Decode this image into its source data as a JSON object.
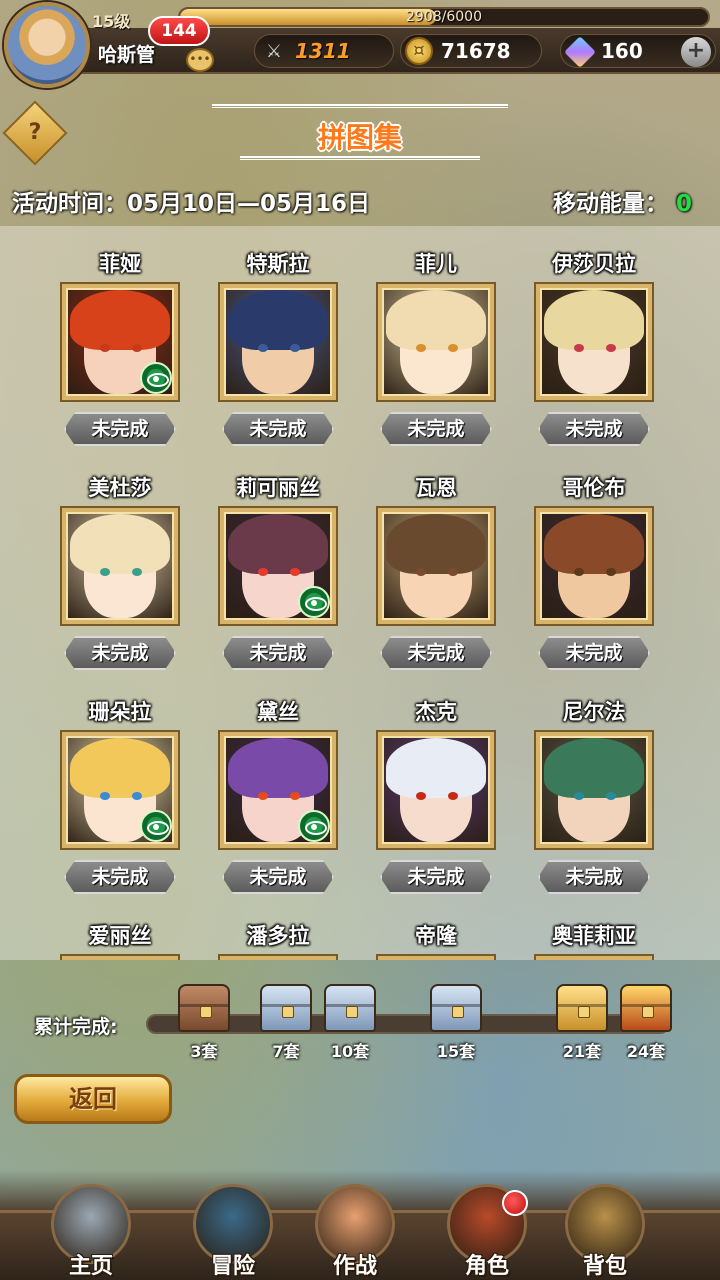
{
  "player": {
    "level": "15级",
    "name": "哈斯管",
    "xp_text": "2908/6000",
    "xp_fraction": 0.485,
    "message_count": "144"
  },
  "resources": {
    "power": "1311",
    "gold": "71678",
    "gems": "160",
    "plus": "+"
  },
  "page": {
    "title": "拼图集",
    "help_symbol": "?",
    "event_time": "活动时间：05月10日—05月16日",
    "move_energy_label": "移动能量：",
    "move_energy_value": "0"
  },
  "cards": [
    {
      "name": "菲娅",
      "status": "未完成",
      "viewable": true,
      "hair": "#d8421a",
      "skin": "#f6d2bc",
      "eye": "#c83a1a",
      "bg": "#8a2a1a"
    },
    {
      "name": "特斯拉",
      "status": "未完成",
      "viewable": false,
      "hair": "#2a3a6a",
      "skin": "#f0cca8",
      "eye": "#3a5a9a",
      "bg": "#4a5a8a"
    },
    {
      "name": "菲儿",
      "status": "未完成",
      "viewable": false,
      "hair": "#f0dcb0",
      "skin": "#fbe6d0",
      "eye": "#d8902a",
      "bg": "#d8c8a0"
    },
    {
      "name": "伊莎贝拉",
      "status": "未完成",
      "viewable": false,
      "hair": "#e8d8a0",
      "skin": "#f6e2cc",
      "eye": "#c83a4a",
      "bg": "#4a3a2a"
    },
    {
      "name": "美杜莎",
      "status": "未完成",
      "viewable": false,
      "hair": "#f2e0b8",
      "skin": "#fbe6d4",
      "eye": "#3aa08a",
      "bg": "#d8c8a8"
    },
    {
      "name": "莉可丽丝",
      "status": "未完成",
      "viewable": true,
      "hair": "#6a3a4a",
      "skin": "#f6d6cc",
      "eye": "#e83a2a",
      "bg": "#3a2a3a"
    },
    {
      "name": "瓦恩",
      "status": "未完成",
      "viewable": false,
      "hair": "#6a4a2e",
      "skin": "#f6d4b4",
      "eye": "#7a4a2a",
      "bg": "#c8a878"
    },
    {
      "name": "哥伦布",
      "status": "未完成",
      "viewable": false,
      "hair": "#8a4a2a",
      "skin": "#f0c8a0",
      "eye": "#5a3a1a",
      "bg": "#3a2a3a"
    },
    {
      "name": "珊朵拉",
      "status": "未完成",
      "viewable": true,
      "hair": "#f2c85a",
      "skin": "#fbe4d0",
      "eye": "#3a8ad8",
      "bg": "#e8d8b0"
    },
    {
      "name": "黛丝",
      "status": "未完成",
      "viewable": true,
      "hair": "#7a4aa8",
      "skin": "#f6d4cc",
      "eye": "#e84a1a",
      "bg": "#3a2a4a"
    },
    {
      "name": "杰克",
      "status": "未完成",
      "viewable": false,
      "hair": "#e8ecf4",
      "skin": "#f6dccc",
      "eye": "#c82a1a",
      "bg": "#5a3a7a"
    },
    {
      "name": "尼尔法",
      "status": "未完成",
      "viewable": false,
      "hair": "#3a7a5a",
      "skin": "#f2d4bc",
      "eye": "#2a8a9a",
      "bg": "#5a5a4a"
    },
    {
      "name": "爱丽丝",
      "status": "",
      "viewable": false,
      "hair": "#f2d890",
      "skin": "#fbe6d4",
      "eye": "#3a7ad8",
      "bg": "#d8c8a8"
    },
    {
      "name": "潘多拉",
      "status": "",
      "viewable": false,
      "hair": "#5a3a6a",
      "skin": "#f6d6cc",
      "eye": "#c83a5a",
      "bg": "#3a2a3a"
    },
    {
      "name": "帝隆",
      "status": "",
      "viewable": false,
      "hair": "#4a3a2a",
      "skin": "#f0cca8",
      "eye": "#5a3a1a",
      "bg": "#6a5a3a"
    },
    {
      "name": "奥菲莉亚",
      "status": "",
      "viewable": false,
      "hair": "#e8c878",
      "skin": "#fbe6d4",
      "eye": "#3a8ad8",
      "bg": "#d8c8a8"
    }
  ],
  "progress": {
    "label": "累计完成:",
    "milestones": [
      {
        "label": "3套",
        "chest": "bronze"
      },
      {
        "label": "7套",
        "chest": "silver"
      },
      {
        "label": "10套",
        "chest": "silver"
      },
      {
        "label": "15套",
        "chest": "silver"
      },
      {
        "label": "21套",
        "chest": "gold"
      },
      {
        "label": "24套",
        "chest": "red"
      }
    ]
  },
  "back_button": "返回",
  "nav": [
    {
      "label": "主页",
      "color": "#9aa8b4",
      "badge": false
    },
    {
      "label": "冒险",
      "color": "#3a6a8a",
      "badge": false
    },
    {
      "label": "作战",
      "color": "#e8a070",
      "badge": false
    },
    {
      "label": "角色",
      "color": "#b84a2a",
      "badge": true
    },
    {
      "label": "背包",
      "color": "#b8904a",
      "badge": false
    }
  ]
}
